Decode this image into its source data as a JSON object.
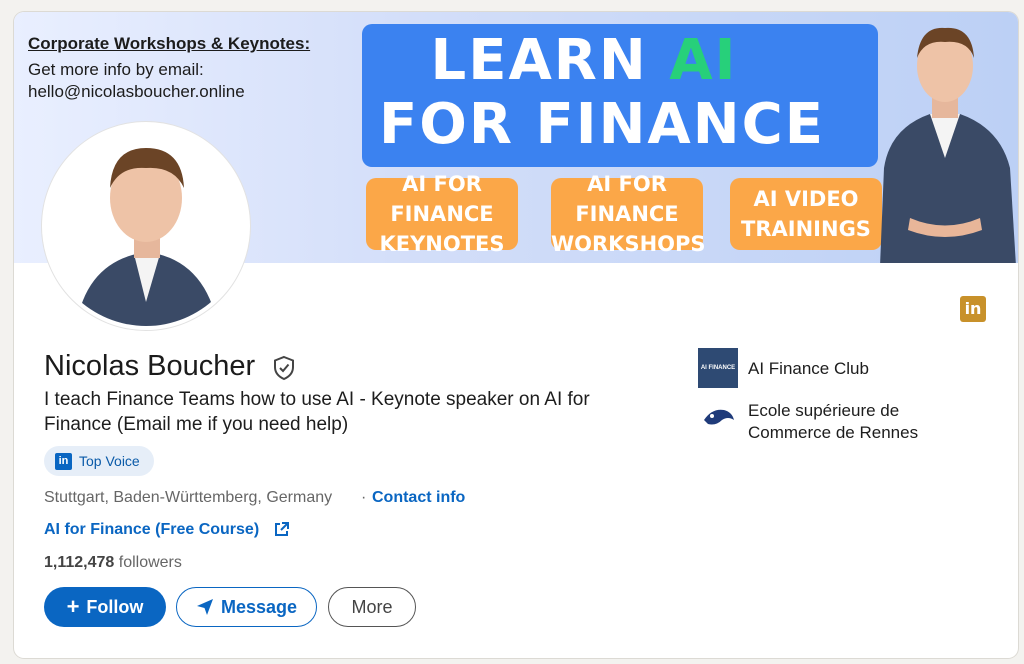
{
  "banner": {
    "promo_title": "Corporate Workshops & Keynotes:",
    "promo_line1": "Get more info by email:",
    "promo_line2": "hello@nicolasboucher.online",
    "hero_line1_prefix": "LEARN ",
    "hero_line1_accent": "AI",
    "hero_line2": "FOR FINANCE",
    "pills": [
      {
        "line1": "AI FOR FINANCE",
        "line2": "KEYNOTES"
      },
      {
        "line1": "AI FOR FINANCE",
        "line2": "WORKSHOPS"
      },
      {
        "line1": "AI VIDEO",
        "line2": "TRAININGS"
      }
    ],
    "colors": {
      "hero_bg": "#3b82f0",
      "accent": "#27d07a",
      "pill": "#fba748"
    }
  },
  "profile": {
    "name": "Nicolas Boucher",
    "headline": "I teach Finance Teams how to use AI - Keynote speaker on AI for Finance (Email me if you need help)",
    "top_voice_badge": "in",
    "top_voice": "Top Voice",
    "location": "Stuttgart, Baden-Württemberg, Germany",
    "separator": "·",
    "contact_info": "Contact info",
    "course_link": "AI for Finance (Free Course)",
    "followers_count": "1,112,478",
    "followers_label": "followers"
  },
  "actions": {
    "follow": "Follow",
    "follow_icon": "+",
    "message": "Message",
    "more": "More"
  },
  "orgs": [
    {
      "logo_text": "AI FINANCE",
      "name": "AI Finance Club"
    },
    {
      "name": "Ecole supérieure de Commerce de Rennes"
    }
  ],
  "corner_badge": "in",
  "icons": [
    "linkedin-icon",
    "verified-shield-icon",
    "external-link-icon",
    "send-icon",
    "plus-icon"
  ],
  "brand_color": "#0a66c2"
}
